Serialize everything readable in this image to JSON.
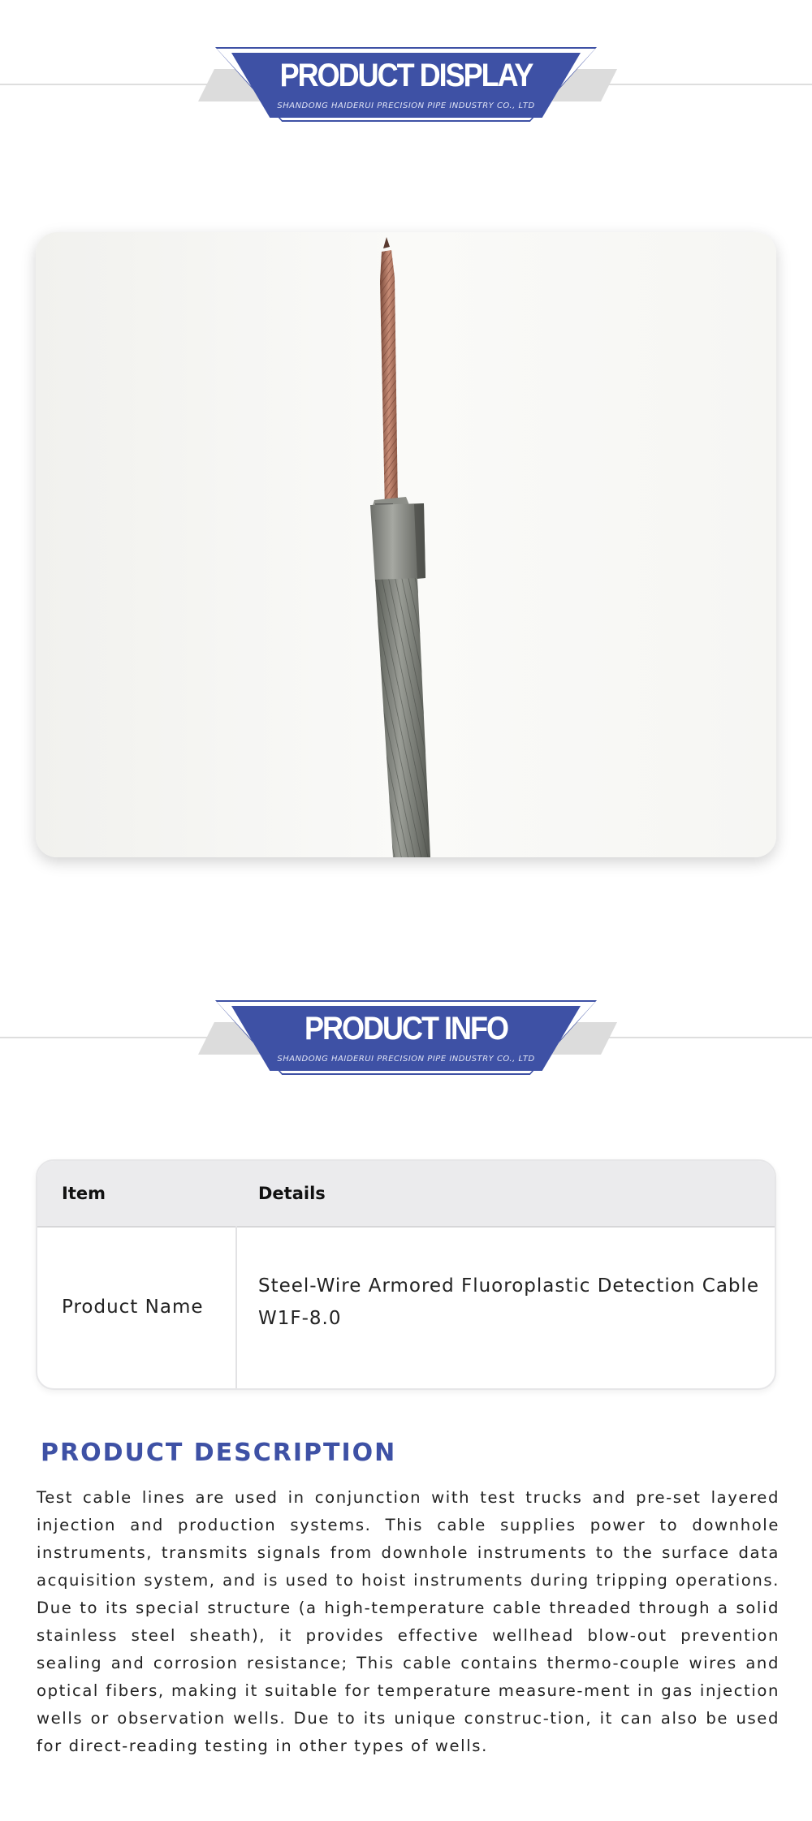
{
  "banners": {
    "display": {
      "title": "PRODUCT DISPLAY",
      "subtitle": "SHANDONG HAIDERUI PRECISION PIPE INDUSTRY CO., LTD"
    },
    "info": {
      "title": "PRODUCT INFO",
      "subtitle": "SHANDONG HAIDERUI PRECISION PIPE INDUSTRY CO., LTD"
    }
  },
  "product_image": {
    "subject": "steel-wire armored cable with exposed copper core"
  },
  "info_table": {
    "headers": {
      "item": "Item",
      "details": "Details"
    },
    "rows": [
      {
        "item": "Product Name",
        "details_line1": "Steel-Wire Armored Fluoroplastic Detection Cable",
        "details_line2": "W1F-8.0"
      }
    ]
  },
  "description": {
    "title": "PRODUCT DESCRIPTION",
    "body": "Test cable lines are used in conjunction with test trucks and pre-set layered injection and production systems. This cable supplies power to downhole instruments, transmits signals from downhole instruments to the surface data acquisition system, and is used to hoist instruments during tripping operations. Due to its special structure (a high-temperature cable threaded through a solid stainless steel sheath), it provides effective wellhead blow-out prevention sealing and corrosion resistance; This cable contains thermo-couple wires and optical fibers, making it suitable for temperature measure-ment in gas injection wells or observation wells. Due to its unique construc-tion, it can also be used for direct-reading testing in other types of wells."
  },
  "colors": {
    "brand_blue": "#3e51a5",
    "banner_shadow": "#dcdcdc",
    "table_header_bg": "#ebebed"
  }
}
